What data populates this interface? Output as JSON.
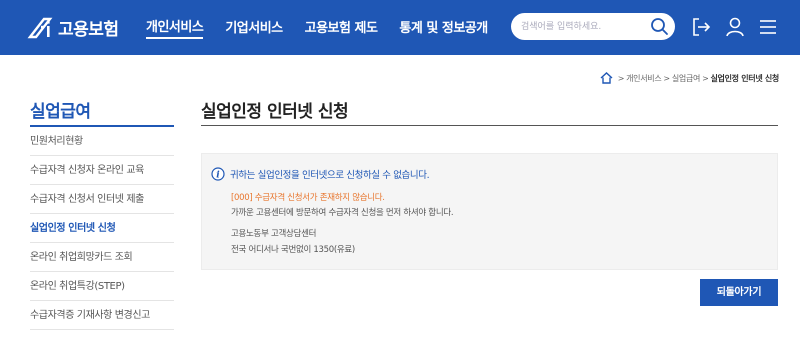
{
  "header": {
    "logo_text": "고용보험",
    "nav": [
      {
        "label": "개인서비스"
      },
      {
        "label": "기업서비스"
      },
      {
        "label": "고용보험 제도"
      },
      {
        "label": "통계 및 정보공개"
      }
    ],
    "search": {
      "placeholder": "검색어를 입력하세요."
    }
  },
  "breadcrumb": {
    "items": [
      "개인서비스",
      "실업급여"
    ],
    "current": "실업인정 인터넷 신청"
  },
  "sidebar": {
    "title": "실업급여",
    "items": [
      {
        "label": "민원처리현황"
      },
      {
        "label": "수급자격 신청자 온라인 교육"
      },
      {
        "label": "수급자격 신청서 인터넷 제출"
      },
      {
        "label": "실업인정 인터넷 신청"
      },
      {
        "label": "온라인 취업희망카드 조회"
      },
      {
        "label": "온라인 취업특강(STEP)"
      },
      {
        "label": "수급자격증 기재사항 변경신고"
      }
    ]
  },
  "main": {
    "title": "실업인정 인터넷 신청",
    "notice": {
      "heading": "귀하는 실업인정을 인터넷으로 신청하실 수 없습니다.",
      "error": "[000] 수급자격 신청서가 존재하지 않습니다.",
      "guide": "가까운 고용센터에 방문하여 수급자격 신청을 먼저 하셔야 합니다.",
      "contact_name": "고용노동부 고객상담센터",
      "contact_phone": "전국 어디서나 국번없이 1350(유료)"
    },
    "back_label": "되돌아가기"
  },
  "colors": {
    "brand": "#1f57b5",
    "error": "#e8762e"
  }
}
